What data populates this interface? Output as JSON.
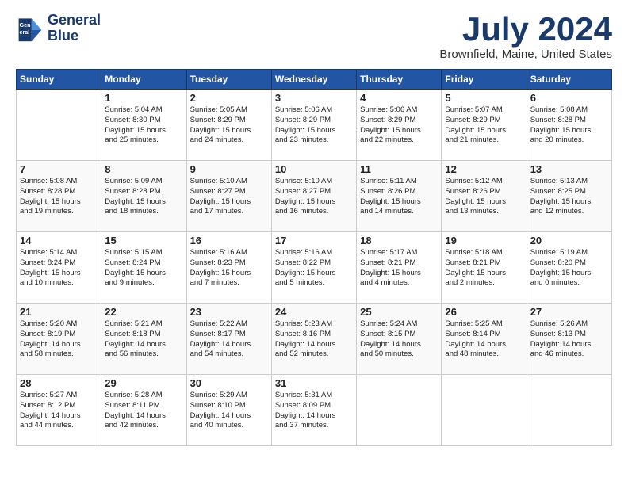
{
  "header": {
    "logo_line1": "General",
    "logo_line2": "Blue",
    "month": "July 2024",
    "location": "Brownfield, Maine, United States"
  },
  "weekdays": [
    "Sunday",
    "Monday",
    "Tuesday",
    "Wednesday",
    "Thursday",
    "Friday",
    "Saturday"
  ],
  "weeks": [
    [
      {
        "num": "",
        "info": ""
      },
      {
        "num": "1",
        "info": "Sunrise: 5:04 AM\nSunset: 8:30 PM\nDaylight: 15 hours\nand 25 minutes."
      },
      {
        "num": "2",
        "info": "Sunrise: 5:05 AM\nSunset: 8:29 PM\nDaylight: 15 hours\nand 24 minutes."
      },
      {
        "num": "3",
        "info": "Sunrise: 5:06 AM\nSunset: 8:29 PM\nDaylight: 15 hours\nand 23 minutes."
      },
      {
        "num": "4",
        "info": "Sunrise: 5:06 AM\nSunset: 8:29 PM\nDaylight: 15 hours\nand 22 minutes."
      },
      {
        "num": "5",
        "info": "Sunrise: 5:07 AM\nSunset: 8:29 PM\nDaylight: 15 hours\nand 21 minutes."
      },
      {
        "num": "6",
        "info": "Sunrise: 5:08 AM\nSunset: 8:28 PM\nDaylight: 15 hours\nand 20 minutes."
      }
    ],
    [
      {
        "num": "7",
        "info": "Sunrise: 5:08 AM\nSunset: 8:28 PM\nDaylight: 15 hours\nand 19 minutes."
      },
      {
        "num": "8",
        "info": "Sunrise: 5:09 AM\nSunset: 8:28 PM\nDaylight: 15 hours\nand 18 minutes."
      },
      {
        "num": "9",
        "info": "Sunrise: 5:10 AM\nSunset: 8:27 PM\nDaylight: 15 hours\nand 17 minutes."
      },
      {
        "num": "10",
        "info": "Sunrise: 5:10 AM\nSunset: 8:27 PM\nDaylight: 15 hours\nand 16 minutes."
      },
      {
        "num": "11",
        "info": "Sunrise: 5:11 AM\nSunset: 8:26 PM\nDaylight: 15 hours\nand 14 minutes."
      },
      {
        "num": "12",
        "info": "Sunrise: 5:12 AM\nSunset: 8:26 PM\nDaylight: 15 hours\nand 13 minutes."
      },
      {
        "num": "13",
        "info": "Sunrise: 5:13 AM\nSunset: 8:25 PM\nDaylight: 15 hours\nand 12 minutes."
      }
    ],
    [
      {
        "num": "14",
        "info": "Sunrise: 5:14 AM\nSunset: 8:24 PM\nDaylight: 15 hours\nand 10 minutes."
      },
      {
        "num": "15",
        "info": "Sunrise: 5:15 AM\nSunset: 8:24 PM\nDaylight: 15 hours\nand 9 minutes."
      },
      {
        "num": "16",
        "info": "Sunrise: 5:16 AM\nSunset: 8:23 PM\nDaylight: 15 hours\nand 7 minutes."
      },
      {
        "num": "17",
        "info": "Sunrise: 5:16 AM\nSunset: 8:22 PM\nDaylight: 15 hours\nand 5 minutes."
      },
      {
        "num": "18",
        "info": "Sunrise: 5:17 AM\nSunset: 8:21 PM\nDaylight: 15 hours\nand 4 minutes."
      },
      {
        "num": "19",
        "info": "Sunrise: 5:18 AM\nSunset: 8:21 PM\nDaylight: 15 hours\nand 2 minutes."
      },
      {
        "num": "20",
        "info": "Sunrise: 5:19 AM\nSunset: 8:20 PM\nDaylight: 15 hours\nand 0 minutes."
      }
    ],
    [
      {
        "num": "21",
        "info": "Sunrise: 5:20 AM\nSunset: 8:19 PM\nDaylight: 14 hours\nand 58 minutes."
      },
      {
        "num": "22",
        "info": "Sunrise: 5:21 AM\nSunset: 8:18 PM\nDaylight: 14 hours\nand 56 minutes."
      },
      {
        "num": "23",
        "info": "Sunrise: 5:22 AM\nSunset: 8:17 PM\nDaylight: 14 hours\nand 54 minutes."
      },
      {
        "num": "24",
        "info": "Sunrise: 5:23 AM\nSunset: 8:16 PM\nDaylight: 14 hours\nand 52 minutes."
      },
      {
        "num": "25",
        "info": "Sunrise: 5:24 AM\nSunset: 8:15 PM\nDaylight: 14 hours\nand 50 minutes."
      },
      {
        "num": "26",
        "info": "Sunrise: 5:25 AM\nSunset: 8:14 PM\nDaylight: 14 hours\nand 48 minutes."
      },
      {
        "num": "27",
        "info": "Sunrise: 5:26 AM\nSunset: 8:13 PM\nDaylight: 14 hours\nand 46 minutes."
      }
    ],
    [
      {
        "num": "28",
        "info": "Sunrise: 5:27 AM\nSunset: 8:12 PM\nDaylight: 14 hours\nand 44 minutes."
      },
      {
        "num": "29",
        "info": "Sunrise: 5:28 AM\nSunset: 8:11 PM\nDaylight: 14 hours\nand 42 minutes."
      },
      {
        "num": "30",
        "info": "Sunrise: 5:29 AM\nSunset: 8:10 PM\nDaylight: 14 hours\nand 40 minutes."
      },
      {
        "num": "31",
        "info": "Sunrise: 5:31 AM\nSunset: 8:09 PM\nDaylight: 14 hours\nand 37 minutes."
      },
      {
        "num": "",
        "info": ""
      },
      {
        "num": "",
        "info": ""
      },
      {
        "num": "",
        "info": ""
      }
    ]
  ]
}
